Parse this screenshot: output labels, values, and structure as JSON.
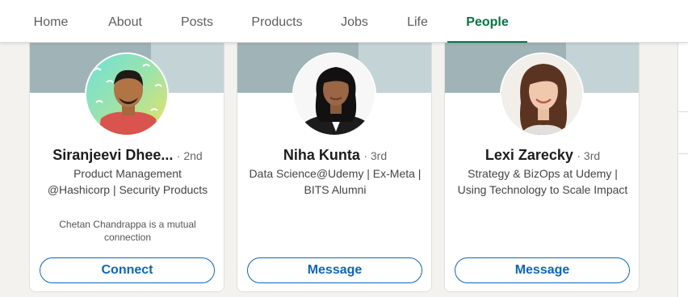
{
  "tabs": [
    {
      "label": "Home"
    },
    {
      "label": "About"
    },
    {
      "label": "Posts"
    },
    {
      "label": "Products"
    },
    {
      "label": "Jobs"
    },
    {
      "label": "Life"
    },
    {
      "label": "People",
      "active": true
    }
  ],
  "people": [
    {
      "name": "Siranjeevi Dhee...",
      "degree": "· 2nd",
      "headline": "Product Management @Hashicorp | Security Products",
      "mutual": "Chetan Chandrappa is a mutual connection",
      "action": "Connect",
      "avatar_icon": "profile-photo-man-red-shirt"
    },
    {
      "name": "Niha Kunta",
      "degree": "· 3rd",
      "headline": "Data Science@Udemy | Ex-Meta | BITS Alumni",
      "mutual": "",
      "action": "Message",
      "avatar_icon": "profile-photo-woman-black-blazer"
    },
    {
      "name": "Lexi Zarecky",
      "degree": "· 3rd",
      "headline": "Strategy & BizOps at Udemy | Using Technology to Scale Impact",
      "mutual": "",
      "action": "Message",
      "avatar_icon": "profile-photo-woman-brown-hair"
    }
  ],
  "colors": {
    "accent_green": "#057642",
    "link_blue": "#0a66c2",
    "banner": "#a0b4b7"
  }
}
